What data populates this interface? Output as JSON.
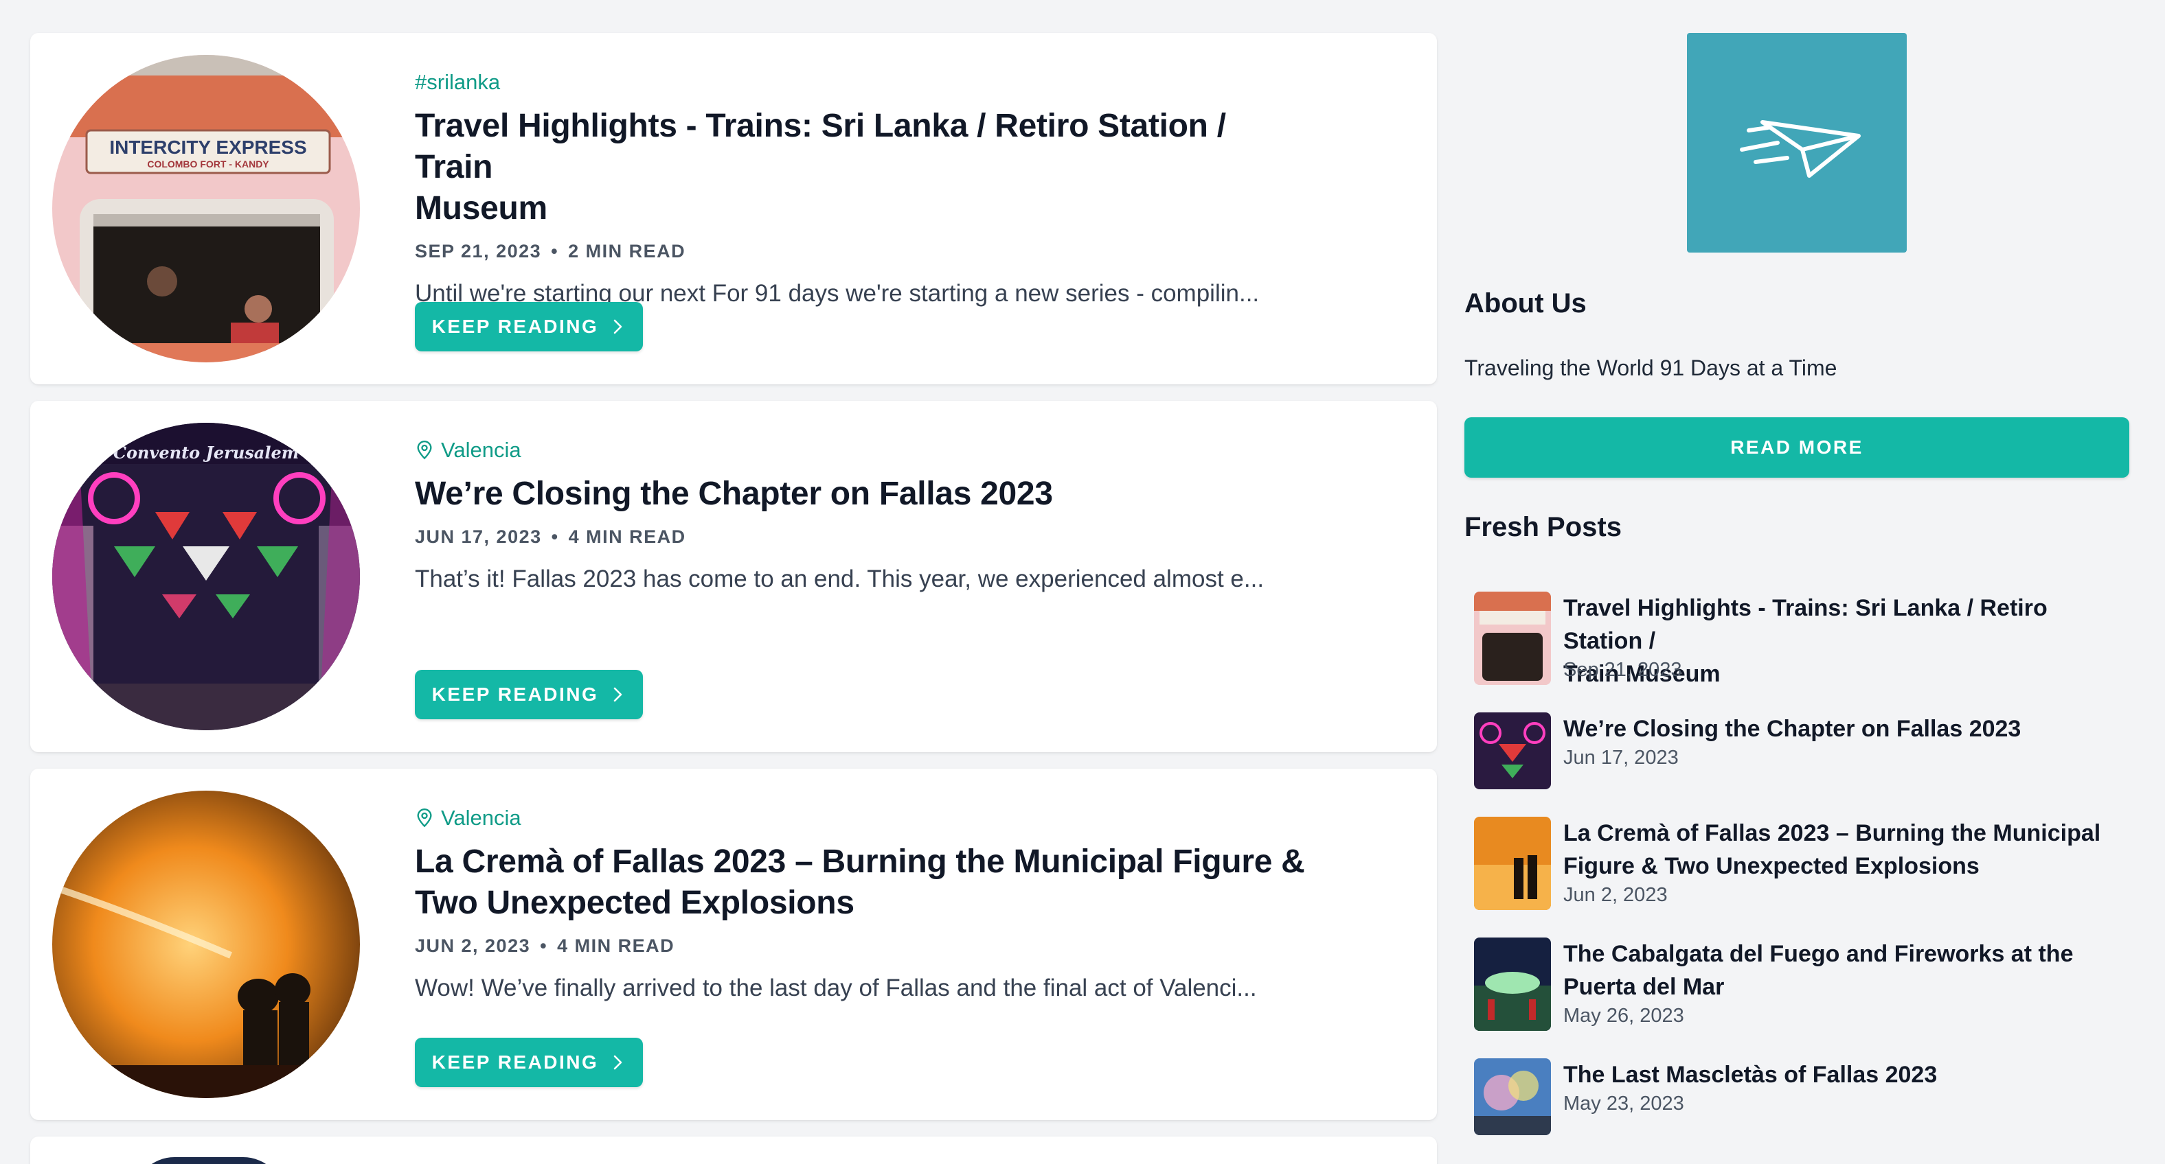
{
  "posts": [
    {
      "tag": "#srilanka",
      "tag_icon": "none",
      "title_line1": "Travel Highlights - Trains: Sri Lanka / Retiro Station / Train",
      "title_line2": "Museum",
      "date": "SEP 21, 2023",
      "read_time": "2 MIN READ",
      "excerpt": "Until we're starting our next For 91 days we're starting a new series - compilin...",
      "button_label": "KEEP READING",
      "image": "intercity-express-train-window"
    },
    {
      "tag": "Valencia",
      "tag_icon": "location-pin-icon",
      "title_line1": "We’re Closing the Chapter on Fallas 2023",
      "title_line2": "",
      "date": "JUN 17, 2023",
      "read_time": "4 MIN READ",
      "excerpt": "That’s it! Fallas 2023 has come to an end. This year, we experienced almost e...",
      "button_label": "KEEP READING",
      "image": "fallas-street-lights"
    },
    {
      "tag": "Valencia",
      "tag_icon": "location-pin-icon",
      "title_line1": "La Cremà of Fallas 2023 – Burning the Municipal Figure &",
      "title_line2": "Two Unexpected Explosions",
      "date": "JUN 2, 2023",
      "read_time": "4 MIN READ",
      "excerpt": "Wow! We’ve finally arrived to the last day of Fallas and the final act of Valenci...",
      "button_label": "KEEP READING",
      "image": "firefighters-burning-figure"
    }
  ],
  "meta_separator": "•",
  "sidebar": {
    "logo_icon": "paper-plane-icon",
    "about_heading": "About Us",
    "about_text": "Traveling the World 91 Days at a Time",
    "read_more_label": "READ MORE",
    "fresh_heading": "Fresh Posts",
    "fresh_posts": [
      {
        "title_line1": "Travel Highlights - Trains: Sri Lanka / Retiro Station /",
        "title_line2": "Train Museum",
        "date": "Sep 21, 2023"
      },
      {
        "title_line1": "We’re Closing the Chapter on Fallas 2023",
        "title_line2": "",
        "date": "Jun 17, 2023"
      },
      {
        "title_line1": "La Cremà of Fallas 2023 – Burning the Municipal",
        "title_line2": "Figure & Two Unexpected Explosions",
        "date": "Jun 2, 2023"
      },
      {
        "title_line1": "The Cabalgata del Fuego and Fireworks at the",
        "title_line2": "Puerta del Mar",
        "date": "May 26, 2023"
      },
      {
        "title_line1": "The Last Mascletàs of Fallas 2023",
        "title_line2": "",
        "date": "May 23, 2023"
      }
    ]
  },
  "colors": {
    "accent": "#14b8a6",
    "tag": "#0f9b87",
    "logo_bg": "#41a6b8",
    "page_bg": "#f3f4f6"
  }
}
